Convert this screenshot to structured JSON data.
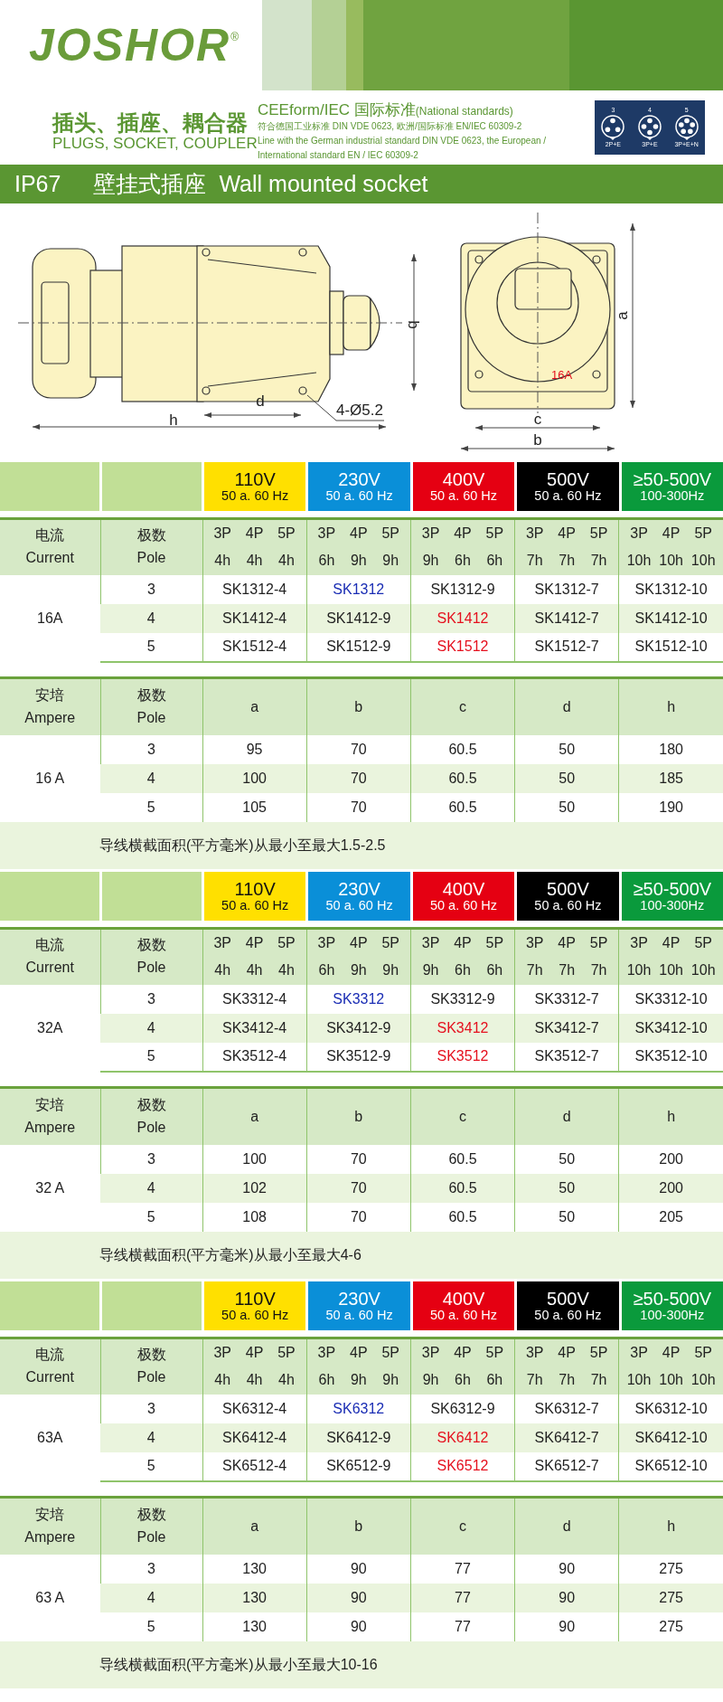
{
  "header": {
    "logo": "JOSHOR",
    "logo_mark": "®",
    "title_cn": "插头、插座、耦合器",
    "title_en": "PLUGS, SOCKET, COUPLER",
    "standard_title": "CEEform/IEC",
    "standard_title_cn": "国际标准",
    "standard_note": "(National standards)",
    "standard_lines": [
      "符合德国工业标准 DIN VDE  0623, 欧洲/国际标准 EN/IEC 60309-2",
      "Line with the German industrial standard DIN VDE 0623, the European /",
      "International standard EN / IEC 60309-2"
    ],
    "pin_layouts": [
      {
        "number": "3",
        "label": "2P+E"
      },
      {
        "number": "4",
        "label": "3P+E"
      },
      {
        "number": "5",
        "label": "3P+E+N"
      }
    ]
  },
  "category": {
    "code": "IP67",
    "title_cn": "壁挂式插座",
    "title_en": "Wall mounted socket"
  },
  "drawings": {
    "side_labels": [
      "b",
      "d",
      "h",
      "4-Ø5.2"
    ],
    "front_labels": [
      "a",
      "c",
      "b"
    ],
    "front_rating": "16A"
  },
  "blocks": [
    {
      "voltages": [
        {
          "voltage": "110V",
          "frequency": "50 a. 60 Hz",
          "color": "#ffe000"
        },
        {
          "voltage": "230V",
          "frequency": "50 a. 60 Hz",
          "color": "#0a8fd8"
        },
        {
          "voltage": "400V",
          "frequency": "50 a. 60 Hz",
          "color": "#e50012"
        },
        {
          "voltage": "500V",
          "frequency": "50 a. 60 Hz",
          "color": "#000000"
        },
        {
          "voltage": "≥50-500V",
          "frequency": "100-300Hz",
          "color": "#0a9a3c"
        }
      ],
      "model_table": {
        "head": [
          "电流",
          "极数",
          "Current",
          "Pole"
        ],
        "columns": [
          {
            "poles": [
              "3P",
              "4P",
              "5P"
            ],
            "hours": [
              "4h",
              "4h",
              "4h"
            ]
          },
          {
            "poles": [
              "3P",
              "4P",
              "5P"
            ],
            "hours": [
              "6h",
              "9h",
              "9h"
            ]
          },
          {
            "poles": [
              "3P",
              "4P",
              "5P"
            ],
            "hours": [
              "9h",
              "6h",
              "6h"
            ]
          },
          {
            "poles": [
              "3P",
              "4P",
              "5P"
            ],
            "hours": [
              "7h",
              "7h",
              "7h"
            ]
          },
          {
            "poles": [
              "3P",
              "4P",
              "5P"
            ],
            "hours": [
              "10h",
              "10h",
              "10h"
            ]
          }
        ],
        "current": "16A",
        "rows": [
          {
            "pole": "3",
            "models": [
              {
                "text": "SK1312-4"
              },
              {
                "text": "SK1312",
                "color": "#1a2db4"
              },
              {
                "text": "SK1312-9"
              },
              {
                "text": "SK1312-7"
              },
              {
                "text": "SK1312-10"
              }
            ]
          },
          {
            "pole": "4",
            "models": [
              {
                "text": "SK1412-4"
              },
              {
                "text": "SK1412-9"
              },
              {
                "text": "SK1412",
                "color": "#e5101e"
              },
              {
                "text": "SK1412-7"
              },
              {
                "text": "SK1412-10"
              }
            ]
          },
          {
            "pole": "5",
            "models": [
              {
                "text": "SK1512-4"
              },
              {
                "text": "SK1512-9"
              },
              {
                "text": "SK1512",
                "color": "#e5101e"
              },
              {
                "text": "SK1512-7"
              },
              {
                "text": "SK1512-10"
              }
            ]
          }
        ]
      },
      "dimension_table": {
        "head": [
          "安培",
          "极数",
          "Ampere",
          "Pole"
        ],
        "columns": [
          "a",
          "b",
          "c",
          "d",
          "h"
        ],
        "ampere": "16 A",
        "rows": [
          {
            "pole": "3",
            "values": [
              "95",
              "70",
              "60.5",
              "50",
              "180"
            ]
          },
          {
            "pole": "4",
            "values": [
              "100",
              "70",
              "60.5",
              "50",
              "185"
            ]
          },
          {
            "pole": "5",
            "values": [
              "105",
              "70",
              "60.5",
              "50",
              "190"
            ]
          }
        ],
        "note": "导线横截面积(平方毫米)从最小至最大1.5-2.5"
      }
    },
    {
      "voltages": [
        {
          "voltage": "110V",
          "frequency": "50 a. 60 Hz",
          "color": "#ffe000"
        },
        {
          "voltage": "230V",
          "frequency": "50 a. 60 Hz",
          "color": "#0a8fd8"
        },
        {
          "voltage": "400V",
          "frequency": "50 a. 60 Hz",
          "color": "#e50012"
        },
        {
          "voltage": "500V",
          "frequency": "50 a. 60 Hz",
          "color": "#000000"
        },
        {
          "voltage": "≥50-500V",
          "frequency": "100-300Hz",
          "color": "#0a9a3c"
        }
      ],
      "model_table": {
        "head": [
          "电流",
          "极数",
          "Current",
          "Pole"
        ],
        "columns": [
          {
            "poles": [
              "3P",
              "4P",
              "5P"
            ],
            "hours": [
              "4h",
              "4h",
              "4h"
            ]
          },
          {
            "poles": [
              "3P",
              "4P",
              "5P"
            ],
            "hours": [
              "6h",
              "9h",
              "9h"
            ]
          },
          {
            "poles": [
              "3P",
              "4P",
              "5P"
            ],
            "hours": [
              "9h",
              "6h",
              "6h"
            ]
          },
          {
            "poles": [
              "3P",
              "4P",
              "5P"
            ],
            "hours": [
              "7h",
              "7h",
              "7h"
            ]
          },
          {
            "poles": [
              "3P",
              "4P",
              "5P"
            ],
            "hours": [
              "10h",
              "10h",
              "10h"
            ]
          }
        ],
        "current": "32A",
        "rows": [
          {
            "pole": "3",
            "models": [
              {
                "text": "SK3312-4"
              },
              {
                "text": "SK3312",
                "color": "#1a2db4"
              },
              {
                "text": "SK3312-9"
              },
              {
                "text": "SK3312-7"
              },
              {
                "text": "SK3312-10"
              }
            ]
          },
          {
            "pole": "4",
            "models": [
              {
                "text": "SK3412-4"
              },
              {
                "text": "SK3412-9"
              },
              {
                "text": "SK3412",
                "color": "#e5101e"
              },
              {
                "text": "SK3412-7"
              },
              {
                "text": "SK3412-10"
              }
            ]
          },
          {
            "pole": "5",
            "models": [
              {
                "text": "SK3512-4"
              },
              {
                "text": "SK3512-9"
              },
              {
                "text": "SK3512",
                "color": "#e5101e"
              },
              {
                "text": "SK3512-7"
              },
              {
                "text": "SK3512-10"
              }
            ]
          }
        ]
      },
      "dimension_table": {
        "head": [
          "安培",
          "极数",
          "Ampere",
          "Pole"
        ],
        "columns": [
          "a",
          "b",
          "c",
          "d",
          "h"
        ],
        "ampere": "32 A",
        "rows": [
          {
            "pole": "3",
            "values": [
              "100",
              "70",
              "60.5",
              "50",
              "200"
            ]
          },
          {
            "pole": "4",
            "values": [
              "102",
              "70",
              "60.5",
              "50",
              "200"
            ]
          },
          {
            "pole": "5",
            "values": [
              "108",
              "70",
              "60.5",
              "50",
              "205"
            ]
          }
        ],
        "note": "导线横截面积(平方毫米)从最小至最大4-6"
      }
    },
    {
      "voltages": [
        {
          "voltage": "110V",
          "frequency": "50 a. 60 Hz",
          "color": "#ffe000"
        },
        {
          "voltage": "230V",
          "frequency": "50 a. 60 Hz",
          "color": "#0a8fd8"
        },
        {
          "voltage": "400V",
          "frequency": "50 a. 60 Hz",
          "color": "#e50012"
        },
        {
          "voltage": "500V",
          "frequency": "50 a. 60 Hz",
          "color": "#000000"
        },
        {
          "voltage": "≥50-500V",
          "frequency": "100-300Hz",
          "color": "#0a9a3c"
        }
      ],
      "model_table": {
        "head": [
          "电流",
          "极数",
          "Current",
          "Pole"
        ],
        "columns": [
          {
            "poles": [
              "3P",
              "4P",
              "5P"
            ],
            "hours": [
              "4h",
              "4h",
              "4h"
            ]
          },
          {
            "poles": [
              "3P",
              "4P",
              "5P"
            ],
            "hours": [
              "6h",
              "9h",
              "9h"
            ]
          },
          {
            "poles": [
              "3P",
              "4P",
              "5P"
            ],
            "hours": [
              "9h",
              "6h",
              "6h"
            ]
          },
          {
            "poles": [
              "3P",
              "4P",
              "5P"
            ],
            "hours": [
              "7h",
              "7h",
              "7h"
            ]
          },
          {
            "poles": [
              "3P",
              "4P",
              "5P"
            ],
            "hours": [
              "10h",
              "10h",
              "10h"
            ]
          }
        ],
        "current": "63A",
        "rows": [
          {
            "pole": "3",
            "models": [
              {
                "text": "SK6312-4"
              },
              {
                "text": "SK6312",
                "color": "#1a2db4"
              },
              {
                "text": "SK6312-9"
              },
              {
                "text": "SK6312-7"
              },
              {
                "text": "SK6312-10"
              }
            ]
          },
          {
            "pole": "4",
            "models": [
              {
                "text": "SK6412-4"
              },
              {
                "text": "SK6412-9"
              },
              {
                "text": "SK6412",
                "color": "#e5101e"
              },
              {
                "text": "SK6412-7"
              },
              {
                "text": "SK6412-10"
              }
            ]
          },
          {
            "pole": "5",
            "models": [
              {
                "text": "SK6512-4"
              },
              {
                "text": "SK6512-9"
              },
              {
                "text": "SK6512",
                "color": "#e5101e"
              },
              {
                "text": "SK6512-7"
              },
              {
                "text": "SK6512-10"
              }
            ]
          }
        ]
      },
      "dimension_table": {
        "head": [
          "安培",
          "极数",
          "Ampere",
          "Pole"
        ],
        "columns": [
          "a",
          "b",
          "c",
          "d",
          "h"
        ],
        "ampere": "63 A",
        "rows": [
          {
            "pole": "3",
            "values": [
              "130",
              "90",
              "77",
              "90",
              "275"
            ]
          },
          {
            "pole": "4",
            "values": [
              "130",
              "90",
              "77",
              "90",
              "275"
            ]
          },
          {
            "pole": "5",
            "values": [
              "130",
              "90",
              "77",
              "90",
              "275"
            ]
          }
        ],
        "note": "导线横截面积(平方毫米)从最小至最大10-16"
      }
    }
  ]
}
